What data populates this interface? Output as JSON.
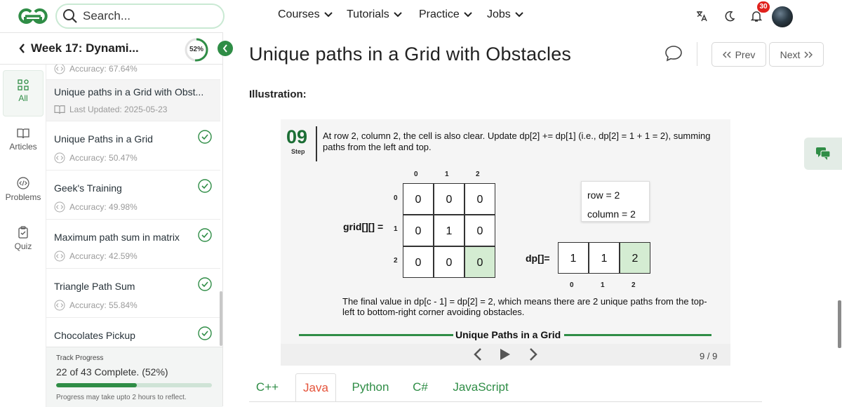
{
  "header": {
    "search_placeholder": "Search...",
    "nav": [
      "Courses",
      "Tutorials",
      "Practice",
      "Jobs"
    ],
    "notification_count": "30"
  },
  "sidebar": {
    "title": "Week 17: Dynami...",
    "progress_label": "52%",
    "progress_fraction": 0.52,
    "rail": [
      "All",
      "Articles",
      "Problems",
      "Quiz"
    ],
    "partial_top": "Accuracy: 67.64%",
    "items": [
      {
        "name": "Unique paths in a Grid with Obst...",
        "sub": "Last Updated: 2025-05-23"
      },
      {
        "name": "Unique Paths in a Grid",
        "sub": "Accuracy: 50.47%"
      },
      {
        "name": "Geek's Training",
        "sub": "Accuracy: 49.98%"
      },
      {
        "name": "Maximum path sum in matrix",
        "sub": "Accuracy: 42.59%"
      },
      {
        "name": "Triangle Path Sum",
        "sub": "Accuracy: 55.84%"
      },
      {
        "name": "Chocolates Pickup",
        "sub": ""
      }
    ],
    "track": {
      "label": "Track Progress",
      "done": "22",
      "of_text": " of ",
      "total": "43",
      "complete_text": " Complete. (52%)",
      "fraction": 0.52,
      "note": "Progress may take upto 2 hours to reflect."
    }
  },
  "main": {
    "title": "Unique paths in a Grid with Obstacles",
    "prev": "Prev",
    "next": "Next",
    "illustration": "Illustration:",
    "slide": {
      "step_number": "09",
      "step_label": "Step",
      "text": "At row 2, column 2, the cell is also clear. Update dp[2] += dp[1] (i.e., dp[2] = 1 + 1 = 2), summing paths from the left and top.",
      "grid_label": "grid[][] =",
      "col_idx": [
        "0",
        "1",
        "2"
      ],
      "row_idx": [
        "0",
        "1",
        "2"
      ],
      "grid": [
        [
          "0",
          "0",
          "0"
        ],
        [
          "0",
          "1",
          "0"
        ],
        [
          "0",
          "0",
          "0"
        ]
      ],
      "info_row": "row = 2",
      "info_col": "column = 2",
      "dp_label": "dp[]=",
      "dp": [
        "1",
        "1",
        "2"
      ],
      "dp_idx": [
        "0",
        "1",
        "2"
      ],
      "footer": "The final value in dp[c - 1] = dp[2] = 2, which means there are 2 unique paths from the top-left to bottom-right corner avoiding obstacles.",
      "slide_title": "Unique Paths in a Grid",
      "counter": "9 / 9"
    },
    "tabs": [
      "C++",
      "Java",
      "Python",
      "C#",
      "JavaScript"
    ],
    "active_tab": "Java"
  },
  "colors": {
    "brand": "#2f8d46",
    "accent_tab": "#e5533a",
    "highlight": "#d4ecd2"
  }
}
